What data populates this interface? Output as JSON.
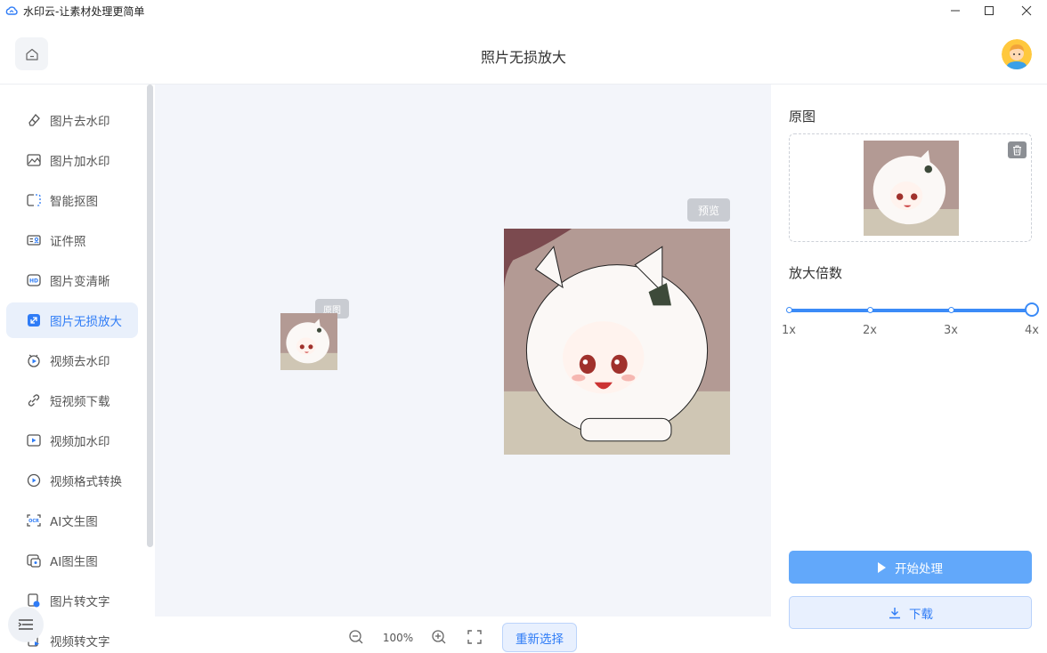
{
  "window": {
    "title": "水印云-让素材处理更简单",
    "controls": [
      "minimize",
      "maximize",
      "close"
    ]
  },
  "header": {
    "title": "照片无损放大",
    "home_icon": "home-icon",
    "avatar_icon": "user-avatar"
  },
  "sidebar": {
    "items": [
      {
        "label": "图片去水印",
        "icon": "eraser-icon",
        "active": false
      },
      {
        "label": "图片加水印",
        "icon": "image-add-icon",
        "active": false
      },
      {
        "label": "智能抠图",
        "icon": "cutout-icon",
        "active": false
      },
      {
        "label": "证件照",
        "icon": "id-card-icon",
        "active": false
      },
      {
        "label": "图片变清晰",
        "icon": "hd-icon",
        "active": false
      },
      {
        "label": "图片无损放大",
        "icon": "expand-icon",
        "active": true
      },
      {
        "label": "视频去水印",
        "icon": "video-eraser-icon",
        "active": false
      },
      {
        "label": "短视频下载",
        "icon": "link-download-icon",
        "active": false
      },
      {
        "label": "视频加水印",
        "icon": "video-add-icon",
        "active": false
      },
      {
        "label": "视频格式转换",
        "icon": "play-circle-icon",
        "active": false
      },
      {
        "label": "AI文生图",
        "icon": "ocr-icon",
        "active": false
      },
      {
        "label": "AI图生图",
        "icon": "image-gen-icon",
        "active": false
      },
      {
        "label": "图片转文字",
        "icon": "image-text-icon",
        "active": false
      },
      {
        "label": "视频转文字",
        "icon": "video-text-icon",
        "active": false
      }
    ],
    "menu_icon": "menu-icon"
  },
  "canvas": {
    "original_tag": "原图",
    "preview_tag": "预览"
  },
  "zoombar": {
    "zoom_level": "100%",
    "reselect_label": "重新选择"
  },
  "panel": {
    "original_label": "原图",
    "scale_label": "放大倍数",
    "scale_ticks": [
      "1x",
      "2x",
      "3x",
      "4x"
    ],
    "selected_scale": "4x",
    "start_label": "开始处理",
    "download_label": "下载"
  },
  "colors": {
    "accent": "#2f7cf6",
    "button_primary": "#62a8fa",
    "canvas_bg": "#f3f5fa"
  }
}
